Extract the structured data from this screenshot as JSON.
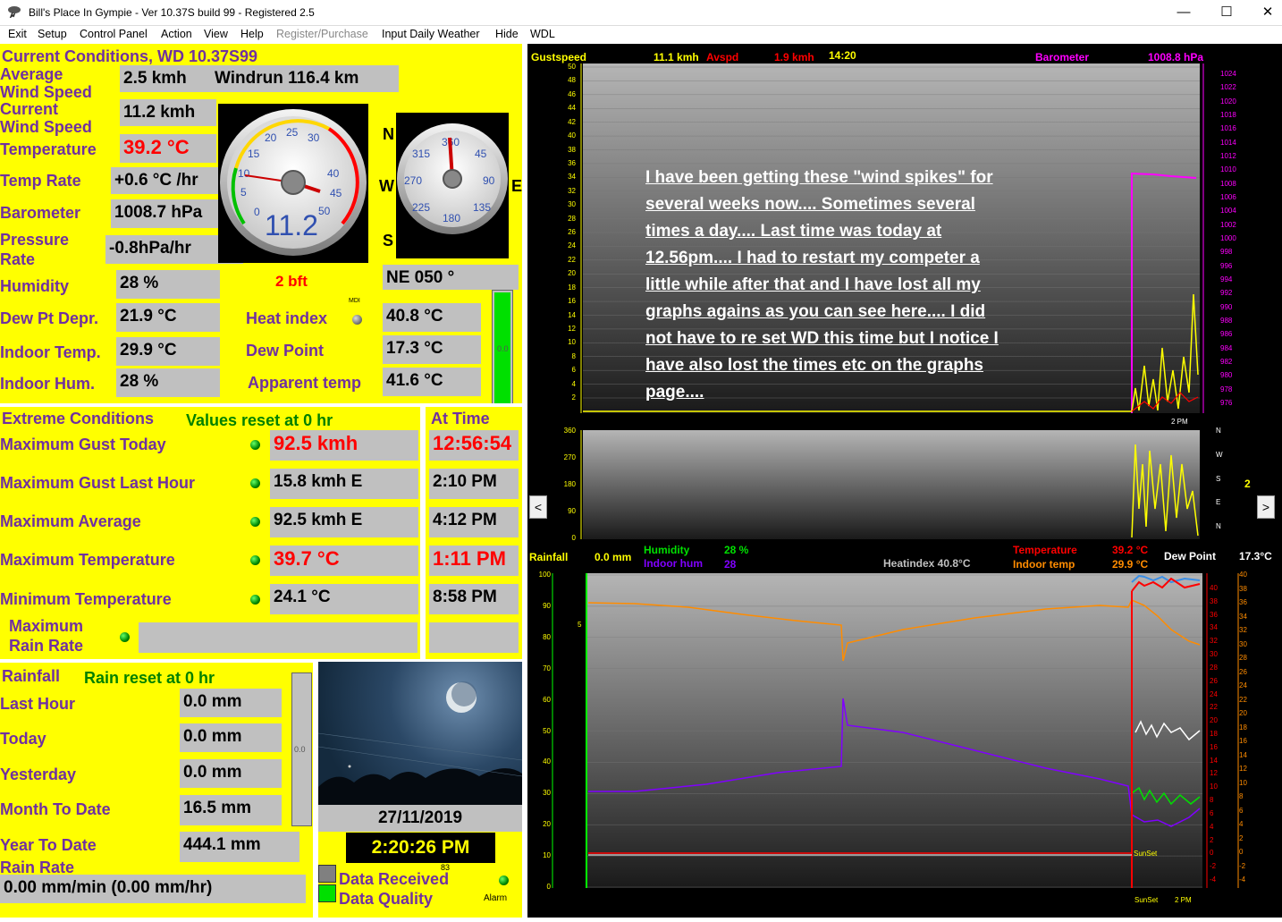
{
  "window": {
    "title": "Bill's Place In Gympie - Ver 10.37S build 99 - Registered 2.5",
    "minimize": "—",
    "maximize": "☐",
    "close": "✕"
  },
  "menu": [
    "Exit",
    "Setup",
    "Control Panel",
    "Action",
    "View",
    "Help",
    "Register/Purchase",
    "Input Daily Weather",
    "Hide",
    "WDL"
  ],
  "current": {
    "heading": "Current Conditions, WD 10.37S99",
    "avg_wind_label_1": "Average",
    "avg_wind_label_2": "Wind Speed",
    "avg_wind_value": "2.5 kmh",
    "windrun": "Windrun 116.4 km",
    "cur_wind_label_1": "Current",
    "cur_wind_label_2": "Wind Speed",
    "cur_wind_value": "11.2 kmh",
    "temp_label": "Temperature",
    "temp_value": "39.2 °C",
    "temprate_label": "Temp Rate",
    "temprate_value": "+0.6 °C /hr",
    "baro_label": "Barometer",
    "baro_value": "1008.7 hPa",
    "pressrate_label_1": "Pressure",
    "pressrate_label_2": "Rate",
    "pressrate_value": "-0.8hPa/hr",
    "humidity_label": "Humidity",
    "humidity_value": "28 %",
    "beaufort": "2 bft",
    "dewdep_label": "Dew Pt Depr.",
    "dewdep_value": "21.9 °C",
    "indoortemp_label": "Indoor Temp.",
    "indoortemp_value": "29.9 °C",
    "indoorhum_label": "Indoor Hum.",
    "indoorhum_value": "28 %",
    "heatindex_label": "Heat index",
    "heatindex_value": "40.8 °C",
    "dewpoint_label": "Dew Point",
    "dewpoint_value": "17.3 °C",
    "apparent_label": "Apparent temp",
    "apparent_value": "41.6 °C",
    "direction_value": "NE  050 °",
    "mdi": "MDI",
    "bar_value": "0.0",
    "gauge_speed": "11.2",
    "compass": {
      "n": "N",
      "e": "E",
      "s": "S",
      "w": "W"
    }
  },
  "extreme": {
    "heading": "Extreme Conditions",
    "reset_note": "Values reset at 0 hr",
    "at_time": "At Time",
    "rows": [
      {
        "label": "Maximum Gust Today",
        "value": "92.5 kmh",
        "time": "12:56:54",
        "red": true
      },
      {
        "label": "Maximum Gust Last Hour",
        "value": "15.8 kmh    E",
        "time": "2:10 PM",
        "red": false
      },
      {
        "label": "Maximum Average",
        "value": "92.5 kmh E",
        "time": "4:12 PM",
        "red": false
      },
      {
        "label": "Maximum Temperature",
        "value": "39.7 °C",
        "time": "1:11 PM",
        "red": true
      },
      {
        "label": "Minimum Temperature",
        "value": "24.1 °C",
        "time": "8:58 PM",
        "red": false
      }
    ],
    "rainrate_label_1": "Maximum",
    "rainrate_label_2": "Rain Rate"
  },
  "rain": {
    "heading": "Rainfall",
    "reset_note": "Rain reset at 0 hr",
    "rows": [
      {
        "label": "Last Hour",
        "value": "0.0 mm"
      },
      {
        "label": "Today",
        "value": "0.0 mm"
      },
      {
        "label": "Yesterday",
        "value": "0.0 mm"
      },
      {
        "label": "Month To Date",
        "value": "16.5 mm"
      },
      {
        "label": "Year To Date",
        "value": "444.1 mm"
      }
    ],
    "rate_label": "Rain Rate",
    "rate_value": "0.00 mm/min (0.00 mm/hr)",
    "bar_value": "0.0"
  },
  "webcam": {
    "date": "27/11/2019",
    "time": "2:20:26 PM"
  },
  "status": {
    "received": "Data Received",
    "quality": "Data Quality",
    "count": "83",
    "alarm": "Alarm"
  },
  "graph_top": {
    "gust_label": "Gustspeed",
    "gust_value": "11.1 kmh",
    "avg_label": "Avspd",
    "avg_value": "1.9 kmh",
    "time": "14:20",
    "baro_label": "Barometer",
    "baro_value": "1008.8 hPa",
    "left_ticks": [
      "50",
      "48",
      "46",
      "44",
      "42",
      "40",
      "38",
      "36",
      "34",
      "32",
      "30",
      "28",
      "26",
      "24",
      "22",
      "20",
      "18",
      "16",
      "14",
      "12",
      "10",
      "8",
      "6",
      "4",
      "2"
    ],
    "right_ticks": [
      "1024",
      "1022",
      "1020",
      "1018",
      "1016",
      "1014",
      "1012",
      "1010",
      "1008",
      "1006",
      "1004",
      "1002",
      "1000",
      "998",
      "996",
      "994",
      "992",
      "990",
      "988",
      "986",
      "984",
      "982",
      "980",
      "978",
      "976"
    ],
    "time_label": "2 PM"
  },
  "graph_dir": {
    "left_ticks": [
      "360",
      "270",
      "180",
      "90",
      "0"
    ],
    "right_letters": [
      "N",
      "W",
      "S",
      "E",
      "N"
    ],
    "right_value": "2",
    "nav_left": "<",
    "nav_right": ">"
  },
  "graph_bottom": {
    "rain_label": "Rainfall",
    "rain_value": "0.0 mm",
    "hum_label": "Humidity",
    "hum_value": "28 %",
    "indoorhum_label": "Indoor hum",
    "indoorhum_value": "28",
    "heatindex_text": "Heatindex  40.8°C",
    "temp_label": "Temperature",
    "temp_value": "39.2 °C",
    "indoortemp_label": "Indoor temp",
    "indoortemp_value": "29.9 °C",
    "dewpoint_label": "Dew Point",
    "dewpoint_value": "17.3°C",
    "left_ticks": [
      "100",
      "90",
      "80",
      "70",
      "60",
      "50",
      "40",
      "30",
      "20",
      "10",
      "0"
    ],
    "mid_tick": "5",
    "right_ticks": [
      "40",
      "38",
      "36",
      "34",
      "32",
      "30",
      "28",
      "26",
      "24",
      "22",
      "20",
      "18",
      "16",
      "14",
      "12",
      "10",
      "8",
      "6",
      "4",
      "2",
      "0",
      "-2",
      "-4"
    ],
    "sunset": "SunSet",
    "sunset2": "SunSet",
    "time_label": "2 PM"
  },
  "overlay": {
    "lines": [
      "I have been getting these \"wind spikes\" for",
      "several weeks now.... Sometimes several",
      "times a day.... Last time was today at",
      "12.56pm.... I had to restart my competer a",
      "little while after that and I have lost all my",
      "graphs agains as you can see here.... I did",
      "not have to re set WD this time but I notice I",
      "have also lost the times etc on the graphs",
      "page...."
    ]
  },
  "colors": {
    "panel": "#ffff00",
    "label": "#7030a0",
    "note": "#008000",
    "red": "#ff0000",
    "graph_bg": "#000000"
  }
}
